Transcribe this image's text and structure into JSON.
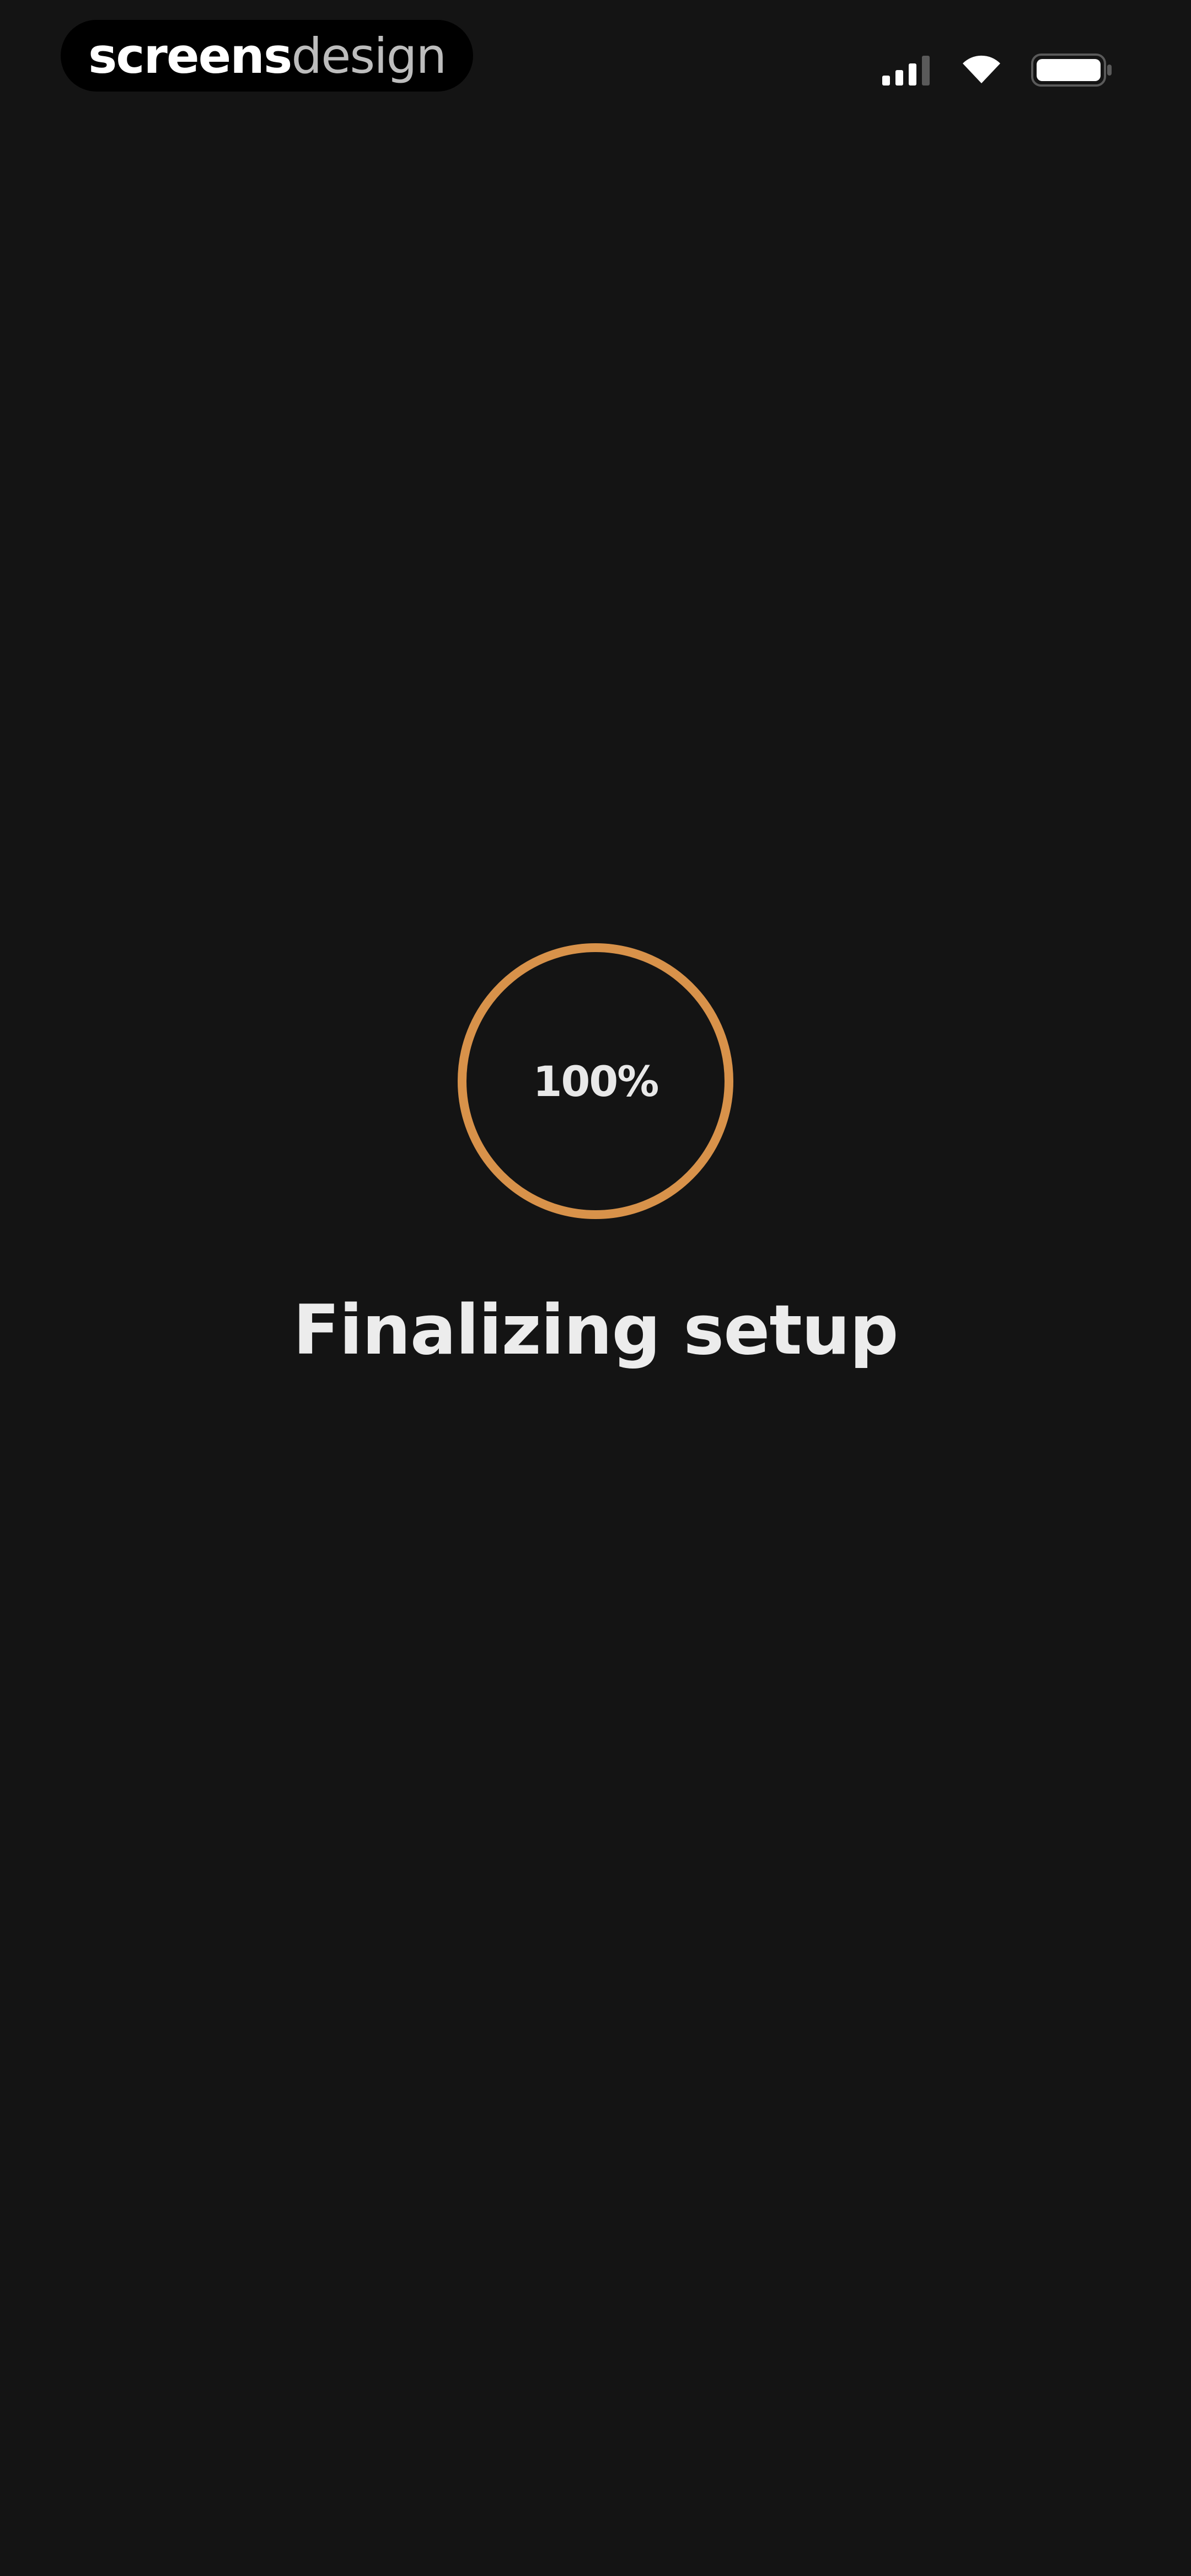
{
  "watermark": {
    "brand_strong": "screens",
    "brand_light": "design"
  },
  "status_bar": {
    "icons": [
      "cellular-signal-icon",
      "wifi-icon",
      "battery-icon"
    ]
  },
  "progress": {
    "label": "100%",
    "value": 1.0,
    "ring_color": "#d8924a"
  },
  "main": {
    "title": "Finalizing setup"
  },
  "colors": {
    "background": "#141414",
    "text": "#ececec",
    "accent": "#d8924a"
  }
}
